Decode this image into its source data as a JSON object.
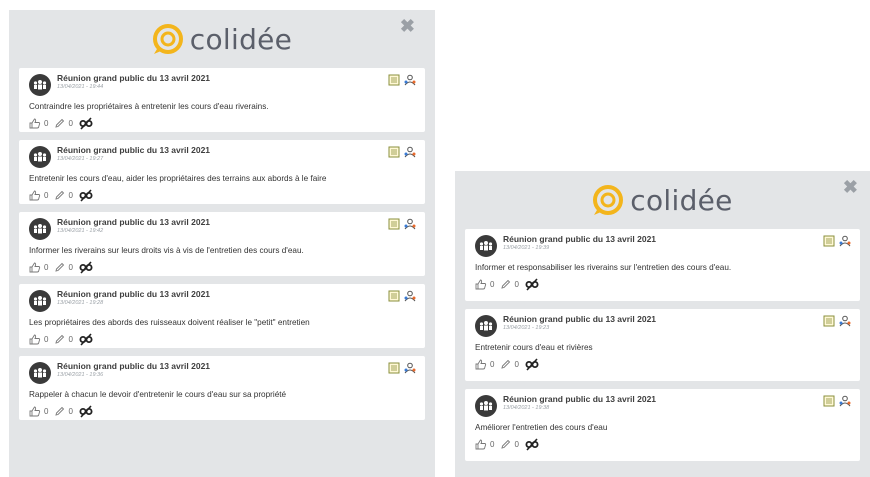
{
  "brand": {
    "name": "colidée",
    "accent": "#f3b51c",
    "text_color": "#5b5f6a"
  },
  "close_label": "✖",
  "left_panel": {
    "cards": [
      {
        "title": "Réunion grand public du 13 avril 2021",
        "date": "13/04/2021 - 19:44",
        "text": "Contraindre les propriétaires à entretenir les cours d'eau riverains.",
        "likes": "0",
        "edits": "0"
      },
      {
        "title": "Réunion grand public du 13 avril 2021",
        "date": "13/04/2021 - 19:27",
        "text": "Entretenir les cours d'eau, aider les propriétaires des terrains aux abords à le faire",
        "likes": "0",
        "edits": "0"
      },
      {
        "title": "Réunion grand public du 13 avril 2021",
        "date": "13/04/2021 - 19:42",
        "text": "Informer les riverains sur leurs droits vis à vis de l'entretien des cours d'eau.",
        "likes": "0",
        "edits": "0"
      },
      {
        "title": "Réunion grand public du 13 avril 2021",
        "date": "13/04/2021 - 19:28",
        "text": "Les propriétaires des abords des ruisseaux doivent réaliser le \"petit\" entretien",
        "likes": "0",
        "edits": "0"
      },
      {
        "title": "Réunion grand public du 13 avril 2021",
        "date": "13/04/2021 - 19:36",
        "text": "Rappeler à chacun le devoir d'entretenir le cours d'eau sur sa propriété",
        "likes": "0",
        "edits": "0"
      }
    ]
  },
  "right_panel": {
    "cards": [
      {
        "title": "Réunion grand public du 13 avril 2021",
        "date": "13/04/2021 - 19:39",
        "text": "Informer et responsabiliser les riverains sur l'entretien des cours d'eau.",
        "likes": "0",
        "edits": "0"
      },
      {
        "title": "Réunion grand public du 13 avril 2021",
        "date": "13/04/2021 - 19:23",
        "text": "Entretenir cours d'eau et rivières",
        "likes": "0",
        "edits": "0"
      },
      {
        "title": "Réunion grand public du 13 avril 2021",
        "date": "13/04/2021 - 19:38",
        "text": "Améliorer l'entretien des cours d'eau",
        "likes": "0",
        "edits": "0"
      }
    ]
  },
  "icons": {
    "avatar": "group-icon",
    "note": "notes-icon",
    "participants": "participants-icon",
    "like": "thumbs-up-icon",
    "edit": "pencil-icon",
    "tag": "tag-icon"
  }
}
